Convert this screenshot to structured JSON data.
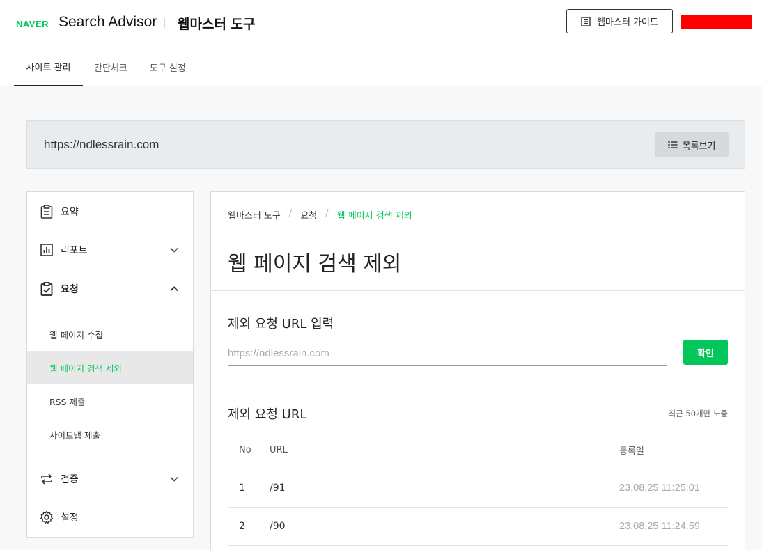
{
  "header": {
    "brand_naver": "NAVER",
    "brand_product": "Search Advisor",
    "brand_tool": "웹마스터 도구",
    "guide_button": "웹마스터 가이드",
    "user_redacted_color": "#ff0000"
  },
  "tabs": [
    {
      "label": "사이트 관리",
      "active": true
    },
    {
      "label": "간단체크",
      "active": false
    },
    {
      "label": "도구 설정",
      "active": false
    }
  ],
  "site": {
    "url": "https://ndlessrain.com",
    "list_button": "목록보기"
  },
  "sidebar": {
    "items": [
      {
        "label": "요약",
        "icon": "clipboard-icon"
      },
      {
        "label": "리포트",
        "icon": "bar-chart-icon",
        "expandable": true,
        "expanded": false
      },
      {
        "label": "요청",
        "icon": "clipboard-check-icon",
        "expandable": true,
        "expanded": true
      },
      {
        "label": "검증",
        "icon": "swap-arrows-icon",
        "expandable": true,
        "expanded": false
      },
      {
        "label": "설정",
        "icon": "gear-icon"
      }
    ],
    "subitems": [
      {
        "label": "웹 페이지 수집",
        "active": false
      },
      {
        "label": "웹 페이지 검색 제외",
        "active": true
      },
      {
        "label": "RSS 제출",
        "active": false
      },
      {
        "label": "사이트맵 제출",
        "active": false
      }
    ]
  },
  "main": {
    "breadcrumb": [
      "웹마스터 도구",
      "요청",
      "웹 페이지 검색 제외"
    ],
    "title": "웹 페이지 검색 제외",
    "input_section_title": "제외 요청 URL 입력",
    "input_placeholder": "https://ndlessrain.com",
    "confirm_button": "확인",
    "list_section_title": "제외 요청 URL",
    "list_note": "최근 50개만 노출",
    "table": {
      "headers": [
        "No",
        "URL",
        "등록일"
      ],
      "rows": [
        {
          "no": "1",
          "url": "/91",
          "date": "23.08.25 11:25:01"
        },
        {
          "no": "2",
          "url": "/90",
          "date": "23.08.25 11:24:59"
        }
      ]
    }
  },
  "colors": {
    "accent": "#03c75a",
    "urlbar_bg": "#e9ecef"
  }
}
